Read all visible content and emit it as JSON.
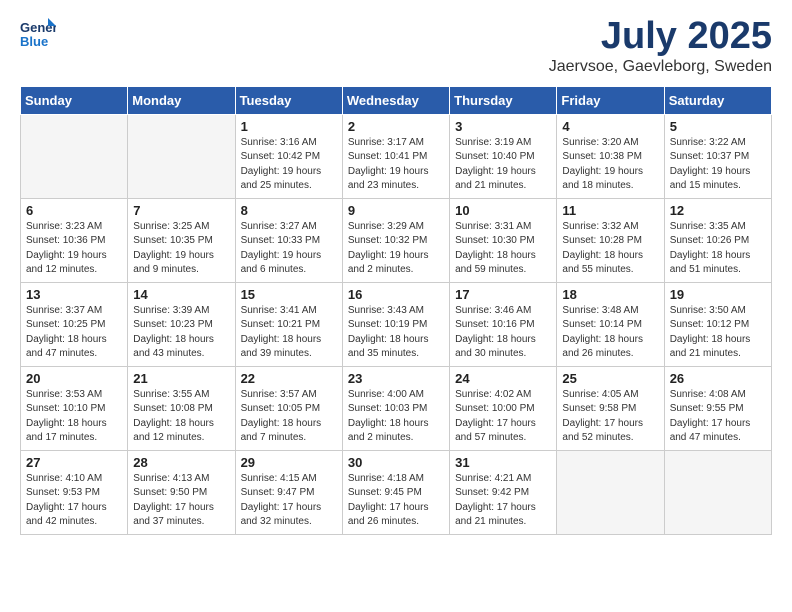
{
  "header": {
    "logo_line1": "General",
    "logo_line2": "Blue",
    "month": "July 2025",
    "location": "Jaervsoe, Gaevleborg, Sweden"
  },
  "weekdays": [
    "Sunday",
    "Monday",
    "Tuesday",
    "Wednesday",
    "Thursday",
    "Friday",
    "Saturday"
  ],
  "weeks": [
    [
      {
        "day": "",
        "info": ""
      },
      {
        "day": "",
        "info": ""
      },
      {
        "day": "1",
        "info": "Sunrise: 3:16 AM\nSunset: 10:42 PM\nDaylight: 19 hours\nand 25 minutes."
      },
      {
        "day": "2",
        "info": "Sunrise: 3:17 AM\nSunset: 10:41 PM\nDaylight: 19 hours\nand 23 minutes."
      },
      {
        "day": "3",
        "info": "Sunrise: 3:19 AM\nSunset: 10:40 PM\nDaylight: 19 hours\nand 21 minutes."
      },
      {
        "day": "4",
        "info": "Sunrise: 3:20 AM\nSunset: 10:38 PM\nDaylight: 19 hours\nand 18 minutes."
      },
      {
        "day": "5",
        "info": "Sunrise: 3:22 AM\nSunset: 10:37 PM\nDaylight: 19 hours\nand 15 minutes."
      }
    ],
    [
      {
        "day": "6",
        "info": "Sunrise: 3:23 AM\nSunset: 10:36 PM\nDaylight: 19 hours\nand 12 minutes."
      },
      {
        "day": "7",
        "info": "Sunrise: 3:25 AM\nSunset: 10:35 PM\nDaylight: 19 hours\nand 9 minutes."
      },
      {
        "day": "8",
        "info": "Sunrise: 3:27 AM\nSunset: 10:33 PM\nDaylight: 19 hours\nand 6 minutes."
      },
      {
        "day": "9",
        "info": "Sunrise: 3:29 AM\nSunset: 10:32 PM\nDaylight: 19 hours\nand 2 minutes."
      },
      {
        "day": "10",
        "info": "Sunrise: 3:31 AM\nSunset: 10:30 PM\nDaylight: 18 hours\nand 59 minutes."
      },
      {
        "day": "11",
        "info": "Sunrise: 3:32 AM\nSunset: 10:28 PM\nDaylight: 18 hours\nand 55 minutes."
      },
      {
        "day": "12",
        "info": "Sunrise: 3:35 AM\nSunset: 10:26 PM\nDaylight: 18 hours\nand 51 minutes."
      }
    ],
    [
      {
        "day": "13",
        "info": "Sunrise: 3:37 AM\nSunset: 10:25 PM\nDaylight: 18 hours\nand 47 minutes."
      },
      {
        "day": "14",
        "info": "Sunrise: 3:39 AM\nSunset: 10:23 PM\nDaylight: 18 hours\nand 43 minutes."
      },
      {
        "day": "15",
        "info": "Sunrise: 3:41 AM\nSunset: 10:21 PM\nDaylight: 18 hours\nand 39 minutes."
      },
      {
        "day": "16",
        "info": "Sunrise: 3:43 AM\nSunset: 10:19 PM\nDaylight: 18 hours\nand 35 minutes."
      },
      {
        "day": "17",
        "info": "Sunrise: 3:46 AM\nSunset: 10:16 PM\nDaylight: 18 hours\nand 30 minutes."
      },
      {
        "day": "18",
        "info": "Sunrise: 3:48 AM\nSunset: 10:14 PM\nDaylight: 18 hours\nand 26 minutes."
      },
      {
        "day": "19",
        "info": "Sunrise: 3:50 AM\nSunset: 10:12 PM\nDaylight: 18 hours\nand 21 minutes."
      }
    ],
    [
      {
        "day": "20",
        "info": "Sunrise: 3:53 AM\nSunset: 10:10 PM\nDaylight: 18 hours\nand 17 minutes."
      },
      {
        "day": "21",
        "info": "Sunrise: 3:55 AM\nSunset: 10:08 PM\nDaylight: 18 hours\nand 12 minutes."
      },
      {
        "day": "22",
        "info": "Sunrise: 3:57 AM\nSunset: 10:05 PM\nDaylight: 18 hours\nand 7 minutes."
      },
      {
        "day": "23",
        "info": "Sunrise: 4:00 AM\nSunset: 10:03 PM\nDaylight: 18 hours\nand 2 minutes."
      },
      {
        "day": "24",
        "info": "Sunrise: 4:02 AM\nSunset: 10:00 PM\nDaylight: 17 hours\nand 57 minutes."
      },
      {
        "day": "25",
        "info": "Sunrise: 4:05 AM\nSunset: 9:58 PM\nDaylight: 17 hours\nand 52 minutes."
      },
      {
        "day": "26",
        "info": "Sunrise: 4:08 AM\nSunset: 9:55 PM\nDaylight: 17 hours\nand 47 minutes."
      }
    ],
    [
      {
        "day": "27",
        "info": "Sunrise: 4:10 AM\nSunset: 9:53 PM\nDaylight: 17 hours\nand 42 minutes."
      },
      {
        "day": "28",
        "info": "Sunrise: 4:13 AM\nSunset: 9:50 PM\nDaylight: 17 hours\nand 37 minutes."
      },
      {
        "day": "29",
        "info": "Sunrise: 4:15 AM\nSunset: 9:47 PM\nDaylight: 17 hours\nand 32 minutes."
      },
      {
        "day": "30",
        "info": "Sunrise: 4:18 AM\nSunset: 9:45 PM\nDaylight: 17 hours\nand 26 minutes."
      },
      {
        "day": "31",
        "info": "Sunrise: 4:21 AM\nSunset: 9:42 PM\nDaylight: 17 hours\nand 21 minutes."
      },
      {
        "day": "",
        "info": ""
      },
      {
        "day": "",
        "info": ""
      }
    ]
  ]
}
